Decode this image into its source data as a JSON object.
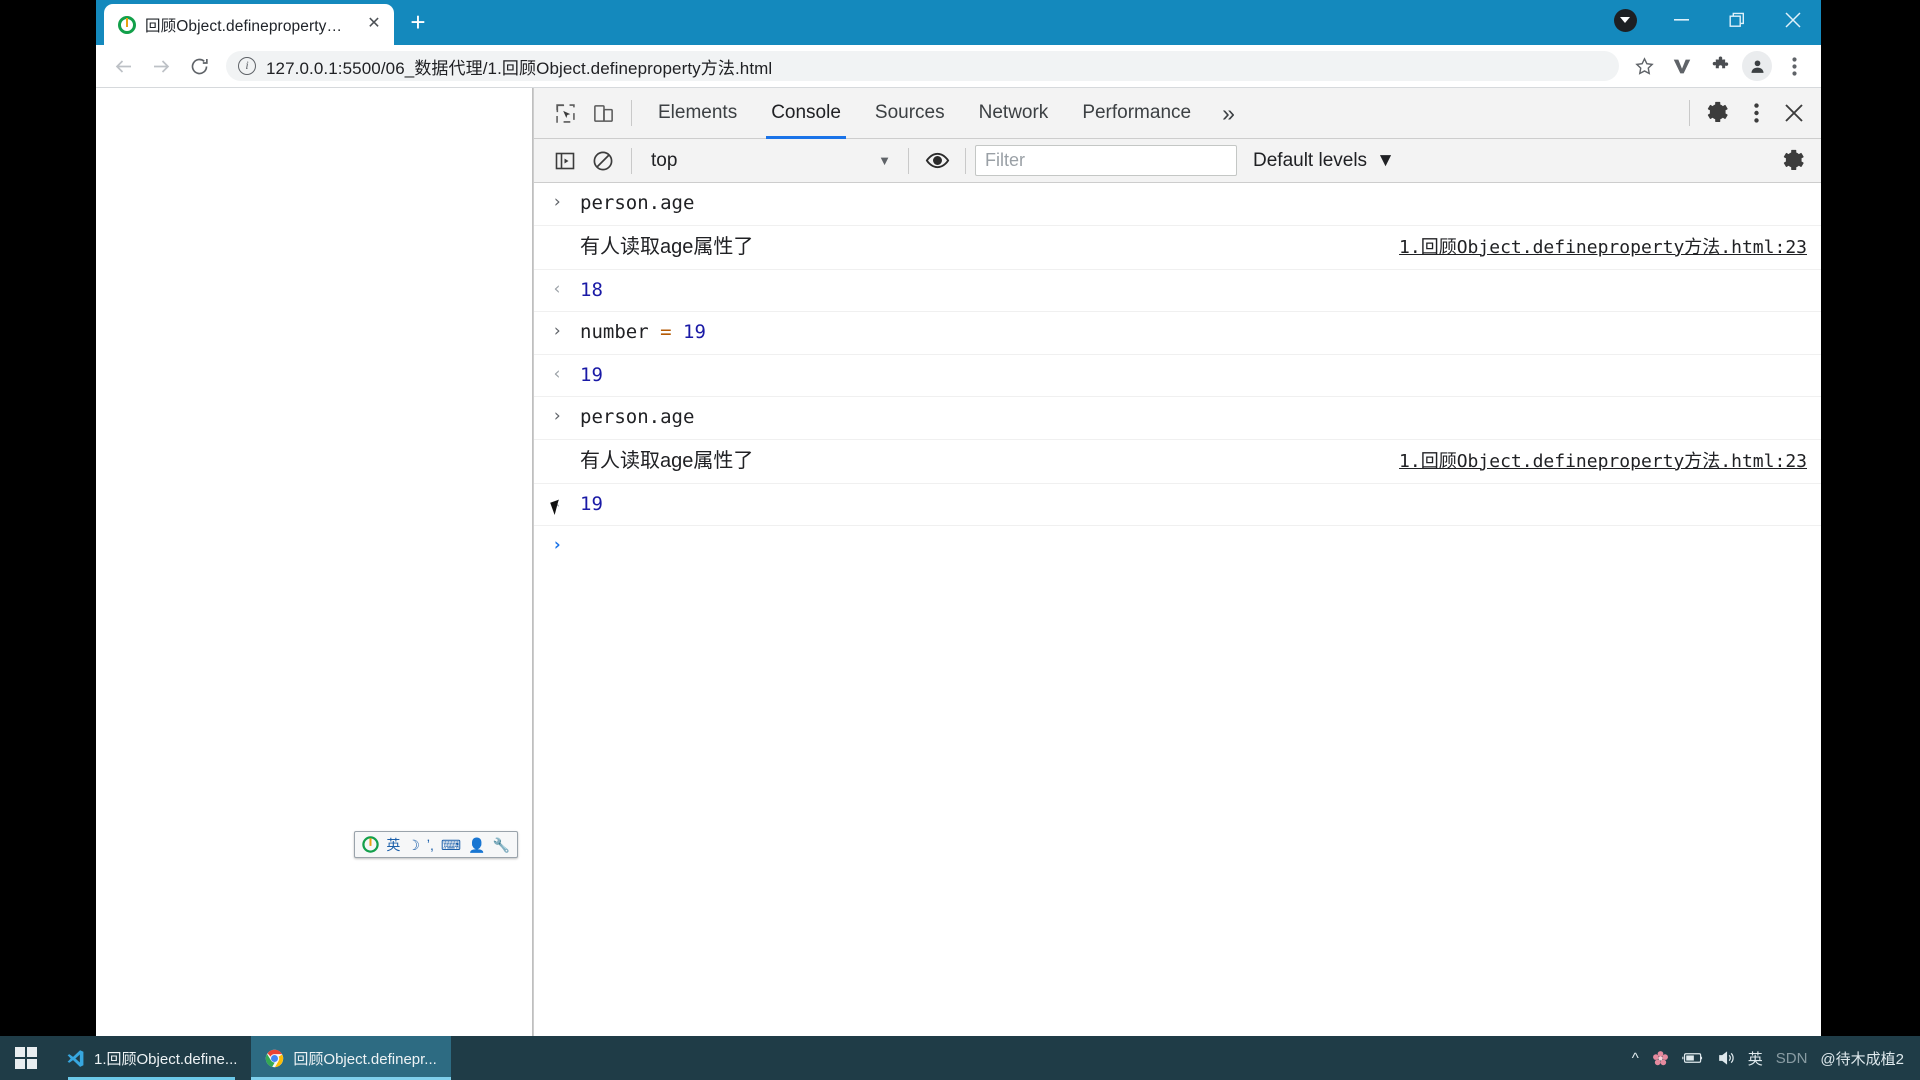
{
  "browser": {
    "tab": {
      "title": "回顾Object.defineproperty方法",
      "favicon_icon": "sogou-logo-icon",
      "close_icon": "close-icon"
    },
    "new_tab_label": "+",
    "window_controls": {
      "download_icon": "download-circle-icon",
      "minimize_label": "—",
      "restore_icon": "restore-window-icon",
      "close_label": "✕"
    },
    "nav": {
      "back_icon": "back-arrow-icon",
      "forward_icon": "forward-arrow-icon",
      "reload_icon": "reload-icon",
      "info_icon": "page-info-icon",
      "url": "127.0.0.1:5500/06_数据代理/1.回顾Object.defineproperty方法.html",
      "bookmark_icon": "star-icon",
      "extension_v_icon": "vimium-extension-icon",
      "extensions_icon": "puzzle-piece-icon",
      "profile_icon": "avatar-icon",
      "menu_icon": "kebab-menu-icon"
    }
  },
  "devtools": {
    "inspect_icon": "inspect-element-icon",
    "device_icon": "device-toolbar-icon",
    "tabs": [
      {
        "label": "Elements",
        "active": false
      },
      {
        "label": "Console",
        "active": true
      },
      {
        "label": "Sources",
        "active": false
      },
      {
        "label": "Network",
        "active": false
      },
      {
        "label": "Performance",
        "active": false
      }
    ],
    "more_tabs_label": "»",
    "settings_icon": "gear-icon",
    "kebab_icon": "kebab-menu-icon",
    "close_icon": "close-icon",
    "console_toolbar": {
      "sidebar_icon": "console-sidebar-icon",
      "clear_icon": "clear-console-icon",
      "context": "top",
      "context_caret": "▼",
      "eye_icon": "live-expression-icon",
      "filter_placeholder": "Filter",
      "filter_value": "",
      "levels_label": "Default levels",
      "levels_caret": "▼",
      "settings_icon": "gear-icon"
    },
    "messages": [
      {
        "kind": "command",
        "gutter": "›",
        "text": "person.age"
      },
      {
        "kind": "log",
        "text": "有人读取age属性了",
        "source": "1.回顾Object.defineproperty方法.html:23"
      },
      {
        "kind": "result",
        "gutter": "‹",
        "value": "18"
      },
      {
        "kind": "command",
        "gutter": "›",
        "text": "number = 19",
        "tokens": [
          {
            "t": "number",
            "c": "plain"
          },
          {
            "t": "=",
            "c": "op"
          },
          {
            "t": "19",
            "c": "num"
          }
        ]
      },
      {
        "kind": "result",
        "gutter": "‹",
        "value": "19"
      },
      {
        "kind": "command",
        "gutter": "›",
        "text": "person.age"
      },
      {
        "kind": "log",
        "text": "有人读取age属性了",
        "source": "1.回顾Object.defineproperty方法.html:23"
      },
      {
        "kind": "result",
        "gutter": "‹",
        "value": "19"
      },
      {
        "kind": "prompt",
        "gutter": "›",
        "text": ""
      }
    ]
  },
  "ime_bar": {
    "items": [
      "英",
      "☽",
      "ʼ,",
      "⌨",
      "👤",
      "🔧"
    ],
    "logo_icon": "sogou-input-icon"
  },
  "taskbar": {
    "start_icon": "windows-start-icon",
    "items": [
      {
        "label": "1.回顾Object.define...",
        "icon": "vscode-icon",
        "active": false
      },
      {
        "label": "回顾Object.definepr...",
        "icon": "chrome-icon",
        "active": true
      }
    ],
    "tray": {
      "chevron": "^",
      "icons": [
        "flower-icon",
        "battery-icon",
        "volume-icon"
      ],
      "ime_label": "英",
      "watermark": "SDN",
      "user": "@待木成植2"
    }
  },
  "colors": {
    "chrome_titlebar": "#1489bd",
    "devtools_accent": "#1a73e8",
    "taskbar": "#1f3c47",
    "result_value": "#1a1aa6"
  }
}
